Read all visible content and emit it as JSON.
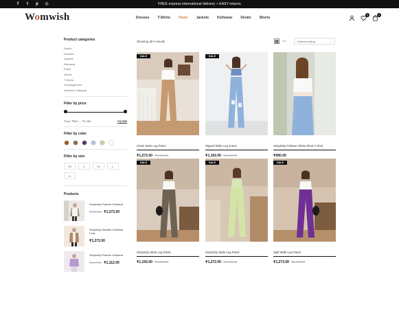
{
  "topbar": {
    "announcement": "FREE express international delivery + EASY returns",
    "social_icons": [
      "facebook-icon",
      "twitter-icon",
      "pinterest-icon",
      "instagram-icon"
    ]
  },
  "header": {
    "logo_prefix": "W",
    "logo_o": "o",
    "logo_suffix": "mwish",
    "nav": [
      "Dresses",
      "T-Shirts",
      "Pants",
      "Jackets",
      "Kishwear",
      "Denim",
      "Shorts"
    ],
    "active_nav": "Pants",
    "wishlist_count": "0",
    "cart_count": "0"
  },
  "sidebar": {
    "categories_title": "Product categories",
    "categories": [
      "Denim",
      "Dresses",
      "Jackets",
      "Kishwear",
      "Pants",
      "Shorts",
      "T-Shirts",
      "Uncategorized",
      "Womens Category"
    ],
    "price_title": "Filter by price",
    "price_range": "Price: ₹560 — ₹1,280",
    "filter_label": "FILTER",
    "color_title": "Filter by color",
    "colors": [
      "#9c5a2e",
      "#8a6b45",
      "#5a2f74",
      "#a9c3e6",
      "#d6c79d",
      "#ffffff"
    ],
    "size_title": "Filter by size",
    "sizes": [
      "XS",
      "S",
      "M",
      "L",
      "XL"
    ],
    "products_title": "Products",
    "products": [
      {
        "name": "Simplicity Pullover Knitwear",
        "old_price": "₹2,600.00",
        "price": "₹1,272.00"
      },
      {
        "name": "Simplicity Sweater Knitwear Coat",
        "old_price": "",
        "price": "₹1,272.00"
      },
      {
        "name": "Simplicity Pullover Knitwear",
        "old_price": "₹2,600.00",
        "price": "₹1,112.00"
      }
    ]
  },
  "main": {
    "showing": "Showing all 6 results",
    "view_count": "3/4",
    "sort_label": "Default sorting",
    "products": [
      {
        "sale": "SALE",
        "name": "Chain Wide Leg Pants",
        "price": "₹1,272.00",
        "old_price": "₹2,490.00"
      },
      {
        "sale": "SALE",
        "name": "Ripped Wide Leg Jeans",
        "price": "₹1,192.00",
        "old_price": "₹2,490.00"
      },
      {
        "sale": "",
        "name": "Simplicity Pullover White Short T-Shirt",
        "price": "₹990.00",
        "old_price": ""
      },
      {
        "sale": "SALE",
        "name": "Simplicity Wide Leg Pants",
        "price": "₹1,192.00",
        "old_price": "₹2,490.00"
      },
      {
        "sale": "SALE",
        "name": "Simplicity Wide Leg Pants",
        "price": "₹1,272.00",
        "old_price": "₹2,490.00"
      },
      {
        "sale": "SALE",
        "name": "Split Wide Leg Pants",
        "price": "₹1,272.00",
        "old_price": "₹2,490.00"
      }
    ]
  }
}
